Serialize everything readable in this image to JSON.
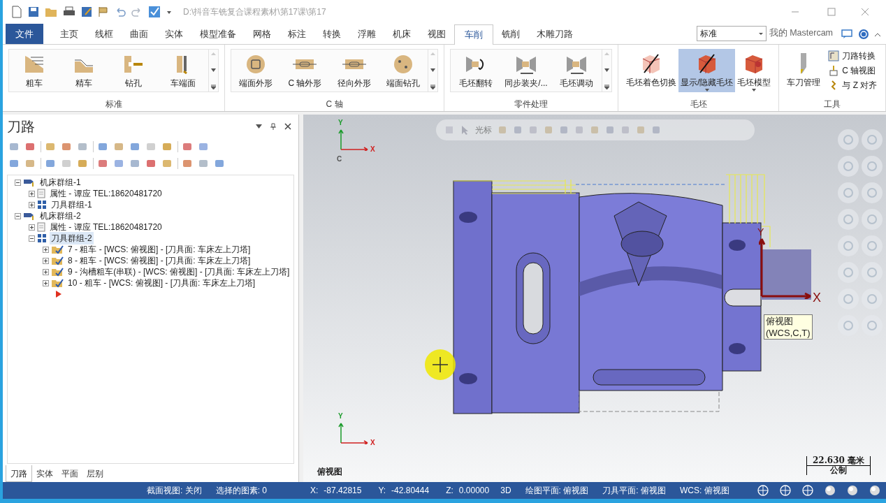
{
  "title_bar": {
    "path": "D:\\抖音车铣复合课程素材\\第17课\\第17"
  },
  "file_button": {
    "label": "文件"
  },
  "ribbon_tabs": [
    {
      "label": "主页",
      "selected": false
    },
    {
      "label": "线框",
      "selected": false
    },
    {
      "label": "曲面",
      "selected": false
    },
    {
      "label": "实体",
      "selected": false
    },
    {
      "label": "模型准备",
      "selected": false
    },
    {
      "label": "网格",
      "selected": false
    },
    {
      "label": "标注",
      "selected": false
    },
    {
      "label": "转换",
      "selected": false
    },
    {
      "label": "浮雕",
      "selected": false
    },
    {
      "label": "机床",
      "selected": false
    },
    {
      "label": "视图",
      "selected": false
    },
    {
      "label": "车削",
      "selected": true
    },
    {
      "label": "铣削",
      "selected": false
    },
    {
      "label": "木雕刀路",
      "selected": false
    }
  ],
  "ribbon_right": {
    "dropdown": "标准",
    "link": "我的 Mastercam"
  },
  "ribbon_groups": [
    {
      "title": "标准",
      "gallery": true,
      "buttons": [
        {
          "label": "粗车",
          "kind": "large",
          "selected": false
        },
        {
          "label": "精车",
          "kind": "large",
          "selected": false
        },
        {
          "label": "钻孔",
          "kind": "large",
          "selected": false
        },
        {
          "label": "车端面",
          "kind": "large",
          "selected": false
        }
      ]
    },
    {
      "title": "C 轴",
      "gallery": true,
      "buttons": [
        {
          "label": "端面外形",
          "kind": "large",
          "selected": false
        },
        {
          "label": "C 轴外形",
          "kind": "large",
          "selected": false
        },
        {
          "label": "径向外形",
          "kind": "large",
          "selected": false
        },
        {
          "label": "端面钻孔",
          "kind": "large",
          "selected": false
        }
      ]
    },
    {
      "title": "零件处理",
      "gallery": true,
      "buttons": [
        {
          "label": "毛坯翻转",
          "kind": "large",
          "selected": false
        },
        {
          "label": "同步装夹/...",
          "kind": "large",
          "selected": false
        },
        {
          "label": "毛坯调动",
          "kind": "large",
          "selected": false
        }
      ]
    },
    {
      "title": "毛坯",
      "gallery": false,
      "buttons": [
        {
          "label": "毛坯着色切换",
          "kind": "large",
          "selected": false
        },
        {
          "label": "显示/隐藏毛坯",
          "kind": "large",
          "selected": true,
          "dropdown": true
        },
        {
          "label": "毛坯模型",
          "kind": "large",
          "selected": false,
          "dropdown": true
        }
      ]
    },
    {
      "title": "工具",
      "gallery": false,
      "buttons": [
        {
          "label": "车刀管理",
          "kind": "large",
          "selected": false
        },
        {
          "label": "刀路转换",
          "kind": "small",
          "selected": false
        },
        {
          "label": "C 轴视图",
          "kind": "small",
          "selected": false
        },
        {
          "label": "与 Z 对齐",
          "kind": "small",
          "selected": false
        }
      ]
    }
  ],
  "panel": {
    "title": "刀路",
    "tree": [
      {
        "label": "机床群组-1",
        "kind": "machine",
        "expanded": true,
        "selected": false,
        "children": [
          {
            "label": "属性 - 谭应 TEL:18620481720",
            "kind": "properties",
            "expanded": false,
            "selected": false
          },
          {
            "label": "刀具群组-1",
            "kind": "toolgroup",
            "expanded": false,
            "selected": false
          }
        ]
      },
      {
        "label": "机床群组-2",
        "kind": "machine",
        "expanded": true,
        "selected": false,
        "children": [
          {
            "label": "属性 - 谭应 TEL:18620481720",
            "kind": "properties",
            "expanded": false,
            "selected": false
          },
          {
            "label": "刀具群组-2",
            "kind": "toolgroup",
            "expanded": true,
            "selected": true,
            "children": [
              {
                "label": "7 - 粗车 - [WCS: 俯视图] - [刀具面: 车床左上刀塔]",
                "kind": "operation",
                "expanded": false,
                "selected": false
              },
              {
                "label": "8 - 粗车 - [WCS: 俯视图] - [刀具面: 车床左上刀塔]",
                "kind": "operation",
                "expanded": false,
                "selected": false
              },
              {
                "label": "9 - 沟槽粗车(串联) - [WCS: 俯视图] - [刀具面: 车床左上刀塔]",
                "kind": "operation",
                "expanded": false,
                "selected": false
              },
              {
                "label": "10 - 粗车 - [WCS: 俯视图] - [刀具面: 车床左上刀塔]",
                "kind": "operation",
                "expanded": false,
                "selected": false
              }
            ]
          }
        ]
      }
    ],
    "tabs": [
      {
        "label": "刀路",
        "selected": true
      },
      {
        "label": "实体",
        "selected": false
      },
      {
        "label": "平面",
        "selected": false
      },
      {
        "label": "层别",
        "selected": false
      }
    ]
  },
  "viewport": {
    "toolbar_label": "光标",
    "top_gnomon": [
      "Y",
      "X",
      "C"
    ],
    "part_axis": [
      "Y",
      "X"
    ],
    "tooltip": [
      "俯视图",
      "(WCS,C,T)"
    ],
    "bottom_gnomon": [
      "Y",
      "X"
    ],
    "view_name": "俯视图",
    "scale": "22.630 毫米",
    "units": "公制"
  },
  "status_bar": [
    {
      "text": "截面视图: 关闭",
      "kind": "text"
    },
    {
      "text": "选择的图素: 0",
      "kind": "text"
    },
    {
      "text": "X:",
      "kind": "label"
    },
    {
      "text": "-87.42815",
      "kind": "value"
    },
    {
      "text": "Y:",
      "kind": "label"
    },
    {
      "text": "-42.80444",
      "kind": "value"
    },
    {
      "text": "Z:",
      "kind": "label"
    },
    {
      "text": "0.00000",
      "kind": "value"
    },
    {
      "text": "3D",
      "kind": "text"
    },
    {
      "text": "绘图平面: 俯视图",
      "kind": "text"
    },
    {
      "text": "刀具平面: 俯视图",
      "kind": "text"
    },
    {
      "text": "WCS: 俯视图",
      "kind": "text"
    }
  ]
}
